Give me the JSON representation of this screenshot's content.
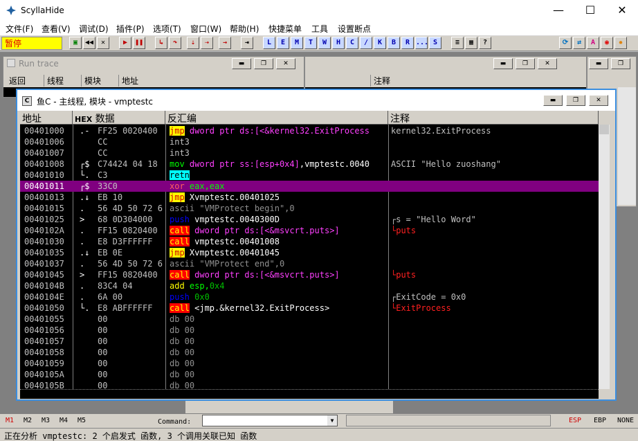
{
  "window": {
    "title": "ScyllaHide"
  },
  "titlebar_buttons": {
    "minimize": "—",
    "maximize": "☐",
    "close": "✕"
  },
  "menu": [
    "文件(F)",
    "查看(V)",
    "调试(D)",
    "插件(P)",
    "选项(T)",
    "窗口(W)",
    "帮助(H)",
    "快捷菜单",
    "工具",
    "设置断点"
  ],
  "toolbar": {
    "status": "暂停",
    "letters": [
      "L",
      "E",
      "M",
      "T",
      "W",
      "H",
      "C",
      "/",
      "K",
      "B",
      "R",
      "...",
      "S"
    ]
  },
  "run_trace": {
    "title": "Run trace",
    "columns": [
      "返回",
      "线程",
      "模块",
      "地址"
    ],
    "right_column": "注释"
  },
  "cpu": {
    "title": "主线程, 模块 - vmptestc",
    "icon_letter": "C",
    "prefix": "鱼C -",
    "columns": {
      "address": "地址",
      "hex": "HEX 数据",
      "disasm": "反汇编",
      "comment": "注释"
    },
    "rows": [
      {
        "addr": "00401000",
        "mk": ".-",
        "hex": "FF25 0020400",
        "dis": [
          [
            "op-jmp",
            "jmp"
          ],
          [
            "",
            ""
          ],
          [
            "opn-mem",
            " dword ptr ds:[<&kernel32.ExitProcess"
          ]
        ],
        "cmt": [
          [
            "",
            "kernel32.ExitProcess"
          ]
        ]
      },
      {
        "addr": "00401006",
        "mk": "",
        "hex": "CC",
        "dis": [
          [
            "op-plain",
            "int3"
          ]
        ],
        "cmt": []
      },
      {
        "addr": "00401007",
        "mk": "",
        "hex": "CC",
        "dis": [
          [
            "op-plain",
            "int3"
          ]
        ],
        "cmt": []
      },
      {
        "addr": "00401008",
        "mk": "┌$",
        "hex": "C74424 04 18",
        "dis": [
          [
            "op-mov",
            "mov"
          ],
          [
            "opn-mem",
            " dword ptr ss:[esp+0x4]"
          ],
          [
            "opn-w",
            ",vmptestc.0040"
          ]
        ],
        "cmt": [
          [
            "",
            "ASCII \"Hello zuoshang\""
          ]
        ]
      },
      {
        "addr": "00401010",
        "mk": "└.",
        "hex": "C3",
        "dis": [
          [
            "op-retn",
            "retn"
          ]
        ],
        "cmt": []
      },
      {
        "addr": "00401011",
        "mk": "┌$",
        "hex": "33C0",
        "dis": [
          [
            "op-xor",
            "xor"
          ],
          [
            "opn-reg",
            " eax,eax"
          ]
        ],
        "cmt": [],
        "sel": true
      },
      {
        "addr": "00401013",
        "mk": ".↓",
        "hex": "EB 10",
        "dis": [
          [
            "op-jmp",
            "jmp"
          ],
          [
            "opn-w",
            " Xvmptestc.00401025"
          ]
        ],
        "cmt": []
      },
      {
        "addr": "00401015",
        "mk": ".",
        "hex": "56 4D 50 72 6",
        "dis": [
          [
            "op-ascii",
            "ascii \"VMProtect begin\",0"
          ]
        ],
        "cmt": []
      },
      {
        "addr": "00401025",
        "mk": ">",
        "hex": "68 0D304000",
        "dis": [
          [
            "op-push",
            "push"
          ],
          [
            "opn-w",
            " vmptestc.0040300D"
          ]
        ],
        "cmt": [
          [
            "",
            "┌s = \"Hello Word\""
          ]
        ]
      },
      {
        "addr": "0040102A",
        "mk": ".",
        "hex": "FF15 0820400",
        "dis": [
          [
            "op-call",
            "call"
          ],
          [
            "opn-mem",
            " dword ptr ds:[<&msvcrt.puts>]"
          ]
        ],
        "cmt": [
          [
            "cmt-red",
            "└puts"
          ]
        ]
      },
      {
        "addr": "00401030",
        "mk": ".",
        "hex": "E8 D3FFFFFF",
        "dis": [
          [
            "op-call",
            "call"
          ],
          [
            "opn-w",
            " vmptestc.00401008"
          ]
        ],
        "cmt": []
      },
      {
        "addr": "00401035",
        "mk": ".↓",
        "hex": "EB 0E",
        "dis": [
          [
            "op-jmp",
            "jmp"
          ],
          [
            "opn-w",
            " Xvmptestc.00401045"
          ]
        ],
        "cmt": []
      },
      {
        "addr": "00401037",
        "mk": ".",
        "hex": "56 4D 50 72 6",
        "dis": [
          [
            "op-ascii",
            "ascii \"VMProtect end\",0"
          ]
        ],
        "cmt": []
      },
      {
        "addr": "00401045",
        "mk": ">",
        "hex": "FF15 0820400",
        "dis": [
          [
            "op-call",
            "call"
          ],
          [
            "opn-mem",
            " dword ptr ds:[<&msvcrt.puts>]"
          ]
        ],
        "cmt": [
          [
            "cmt-red",
            "└puts"
          ]
        ]
      },
      {
        "addr": "0040104B",
        "mk": ".",
        "hex": "83C4 04",
        "dis": [
          [
            "op-add",
            "add"
          ],
          [
            "opn-reg",
            " esp,"
          ],
          [
            "opn-imm",
            "0x4"
          ]
        ],
        "cmt": []
      },
      {
        "addr": "0040104E",
        "mk": ".",
        "hex": "6A 00",
        "dis": [
          [
            "op-push",
            "push"
          ],
          [
            "opn-imm",
            " 0x0"
          ]
        ],
        "cmt": [
          [
            "",
            "┌ExitCode = 0x0"
          ]
        ]
      },
      {
        "addr": "00401050",
        "mk": "└.",
        "hex": "E8 ABFFFFFF",
        "dis": [
          [
            "op-call",
            "call"
          ],
          [
            "opn-w",
            " <jmp.&kernel32.ExitProcess>"
          ]
        ],
        "cmt": [
          [
            "cmt-red",
            "└ExitProcess"
          ]
        ]
      },
      {
        "addr": "00401055",
        "mk": "",
        "hex": "00",
        "dis": [
          [
            "op-ascii",
            "db 00"
          ]
        ],
        "cmt": []
      },
      {
        "addr": "00401056",
        "mk": "",
        "hex": "00",
        "dis": [
          [
            "op-ascii",
            "db 00"
          ]
        ],
        "cmt": []
      },
      {
        "addr": "00401057",
        "mk": "",
        "hex": "00",
        "dis": [
          [
            "op-ascii",
            "db 00"
          ]
        ],
        "cmt": []
      },
      {
        "addr": "00401058",
        "mk": "",
        "hex": "00",
        "dis": [
          [
            "op-ascii",
            "db 00"
          ]
        ],
        "cmt": []
      },
      {
        "addr": "00401059",
        "mk": "",
        "hex": "00",
        "dis": [
          [
            "op-ascii",
            "db 00"
          ]
        ],
        "cmt": []
      },
      {
        "addr": "0040105A",
        "mk": "",
        "hex": "00",
        "dis": [
          [
            "op-ascii",
            "db 00"
          ]
        ],
        "cmt": []
      },
      {
        "addr": "0040105B",
        "mk": "",
        "hex": "00",
        "dis": [
          [
            "op-ascii",
            "db 00"
          ]
        ],
        "cmt": []
      }
    ]
  },
  "command": {
    "markers": [
      "M1",
      "M2",
      "M3",
      "M4",
      "M5"
    ],
    "label": "Command:",
    "regs": [
      "ESP",
      "EBP",
      "NONE"
    ]
  },
  "status": "正在分析 vmptestc: 2 个启发式 函数, 3 个调用关联已知 函数",
  "colors": {
    "accent": "#3b8ee0",
    "selection": "#800080",
    "pause_bg": "#ffff00",
    "pause_text": "#e00000"
  }
}
